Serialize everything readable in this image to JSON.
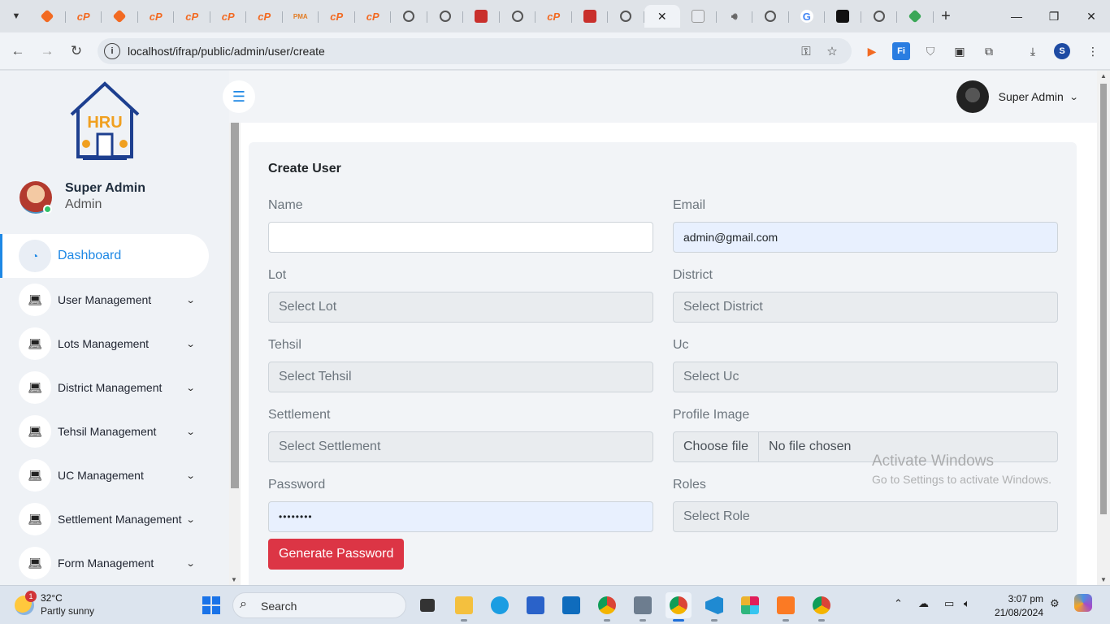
{
  "browser": {
    "active_tab_close": "✕",
    "tab_favicons": [
      "cp-dia",
      "cp",
      "cp-dia",
      "cp",
      "cp",
      "cp",
      "cp",
      "pma",
      "cp",
      "cp",
      "globe",
      "globe",
      "red",
      "globe",
      "cp",
      "red",
      "globe",
      "x",
      "img",
      "spk",
      "globe",
      "google",
      "black",
      "globe",
      "green"
    ],
    "new_tab": "+",
    "url": "localhost/ifrap/public/admin/user/create",
    "profile_initial": "S",
    "window_controls": [
      "—",
      "❐",
      "✕"
    ]
  },
  "sidebar": {
    "user_name": "Super Admin",
    "user_role": "Admin",
    "menu": [
      {
        "label": "Dashboard",
        "icon": "dashboard-icon",
        "active": true,
        "has_chevron": false
      },
      {
        "label": "User Management",
        "icon": "laptop-icon",
        "active": false,
        "has_chevron": true
      },
      {
        "label": "Lots Management",
        "icon": "laptop-icon",
        "active": false,
        "has_chevron": true
      },
      {
        "label": "District Management",
        "icon": "laptop-icon",
        "active": false,
        "has_chevron": true
      },
      {
        "label": "Tehsil Management",
        "icon": "laptop-icon",
        "active": false,
        "has_chevron": true
      },
      {
        "label": "UC Management",
        "icon": "laptop-icon",
        "active": false,
        "has_chevron": true
      },
      {
        "label": "Settlement Management",
        "icon": "laptop-icon",
        "active": false,
        "has_chevron": true
      },
      {
        "label": "Form Management",
        "icon": "laptop-icon",
        "active": false,
        "has_chevron": true
      }
    ]
  },
  "topbar": {
    "user_name": "Super Admin"
  },
  "form": {
    "title": "Create User",
    "name_label": "Name",
    "name_value": "",
    "email_label": "Email",
    "email_value": "admin@gmail.com",
    "lot_label": "Lot",
    "lot_value": "Select Lot",
    "district_label": "District",
    "district_value": "Select District",
    "tehsil_label": "Tehsil",
    "tehsil_value": "Select Tehsil",
    "uc_label": "Uc",
    "uc_value": "Select Uc",
    "settlement_label": "Settlement",
    "settlement_value": "Select Settlement",
    "profile_image_label": "Profile Image",
    "file_button": "Choose file",
    "file_status": "No file chosen",
    "password_label": "Password",
    "password_value": "••••••••",
    "roles_label": "Roles",
    "roles_value": "Select Role",
    "generate_button": "Generate Password"
  },
  "watermark": {
    "line1": "Activate Windows",
    "line2": "Go to Settings to activate Windows."
  },
  "taskbar": {
    "weather_badge": "1",
    "temperature": "32°C",
    "condition": "Partly sunny",
    "search_placeholder": "Search",
    "time": "3:07 pm",
    "date": "21/08/2024"
  },
  "colors": {
    "accent": "#1e88e5",
    "danger": "#dc3545",
    "online": "#31c26b"
  }
}
